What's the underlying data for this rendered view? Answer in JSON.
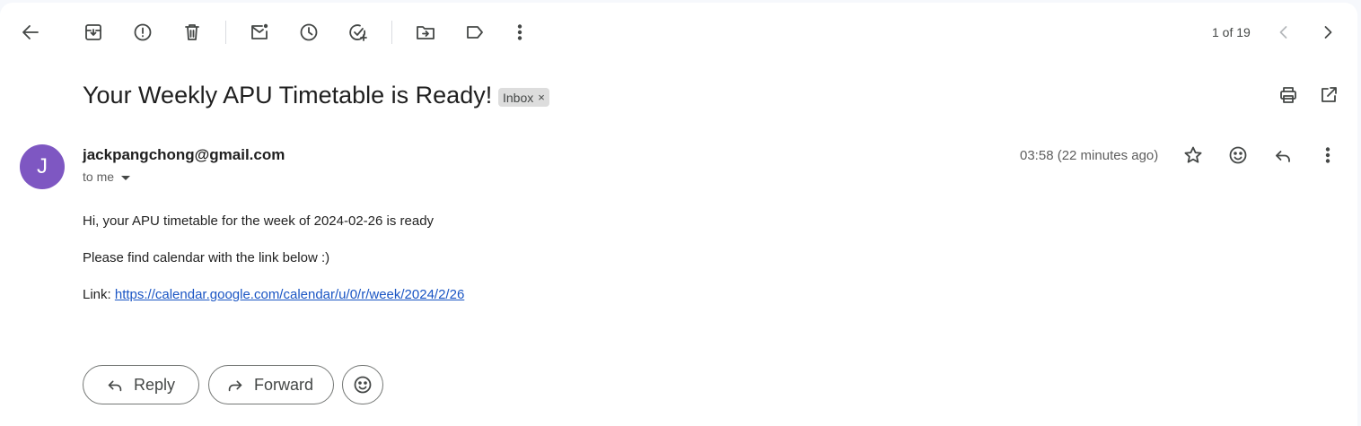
{
  "toolbar": {
    "pager_text": "1 of 19",
    "icons": [
      "arrow-back-icon",
      "archive-icon",
      "report-spam-icon",
      "delete-icon",
      "mark-unread-icon",
      "snooze-icon",
      "add-task-icon",
      "move-to-icon",
      "label-icon",
      "more-vert-icon",
      "chevron-left-icon",
      "chevron-right-icon"
    ]
  },
  "message": {
    "subject": "Your Weekly APU Timetable is Ready!",
    "label_chip": "Inbox",
    "label_remove": "×",
    "avatar_letter": "J",
    "avatar_color": "#7e57c2",
    "sender_email": "jackpangchong@gmail.com",
    "recipient": "to me",
    "timestamp": "03:58 (22 minutes ago)",
    "body": {
      "line1": "Hi, your APU timetable for the week of 2024-02-26 is ready",
      "line2": "Please find calendar with the link below :)",
      "link_prefix": "Link: ",
      "link_text": "https://calendar.google.com/calendar/u/0/r/week/2024/2/26"
    }
  },
  "actions": {
    "reply_label": "Reply",
    "forward_label": "Forward"
  },
  "colors": {
    "link": "#1a55c4",
    "chip_bg": "#dddddd"
  }
}
